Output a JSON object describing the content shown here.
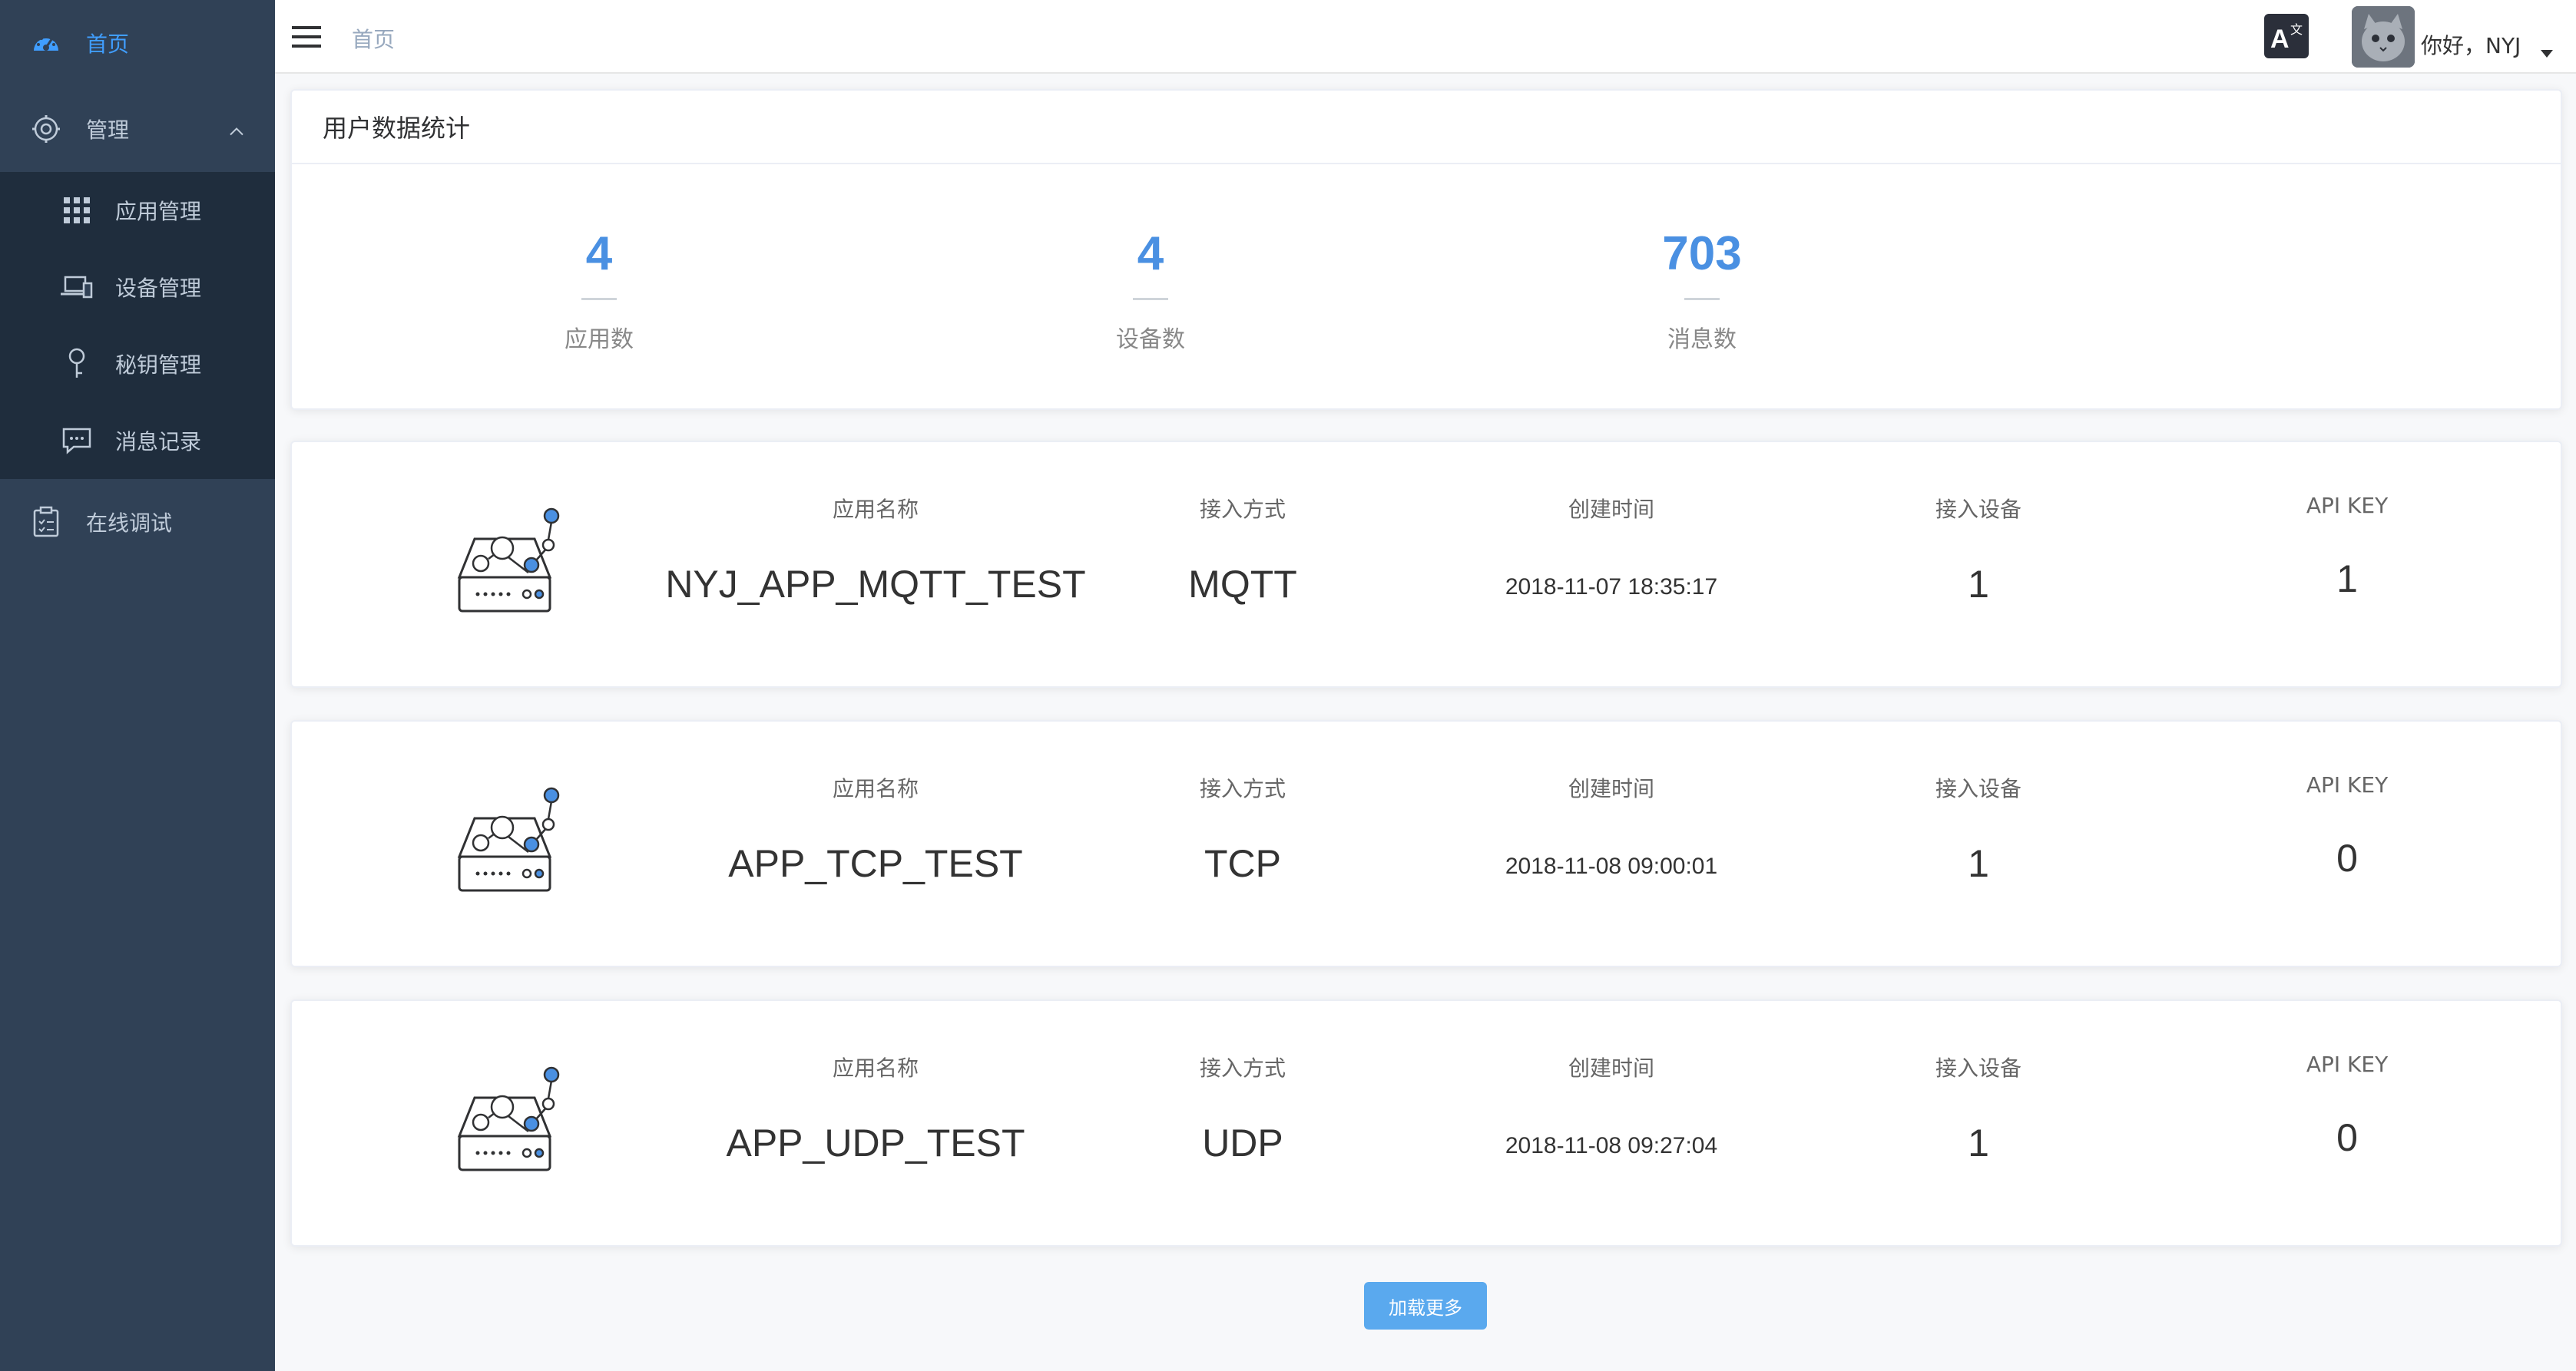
{
  "sidebar": {
    "home": {
      "label": "首页",
      "icon": "dashboard-icon"
    },
    "manage": {
      "label": "管理",
      "icon": "gear-icon"
    },
    "sub": [
      {
        "label": "应用管理",
        "icon": "grid-icon"
      },
      {
        "label": "设备管理",
        "icon": "devices-icon"
      },
      {
        "label": "秘钥管理",
        "icon": "key-icon"
      },
      {
        "label": "消息记录",
        "icon": "message-icon"
      }
    ],
    "debug": {
      "label": "在线调试",
      "icon": "clipboard-icon"
    }
  },
  "navbar": {
    "breadcrumb": "首页",
    "greeting": "你好，NYJ"
  },
  "stats": {
    "title": "用户数据统计",
    "items": [
      {
        "value": "4",
        "label": "应用数"
      },
      {
        "value": "4",
        "label": "设备数"
      },
      {
        "value": "703",
        "label": "消息数"
      }
    ]
  },
  "columns": {
    "name": "应用名称",
    "protocol": "接入方式",
    "created": "创建时间",
    "devices": "接入设备",
    "apikey": "API KEY"
  },
  "apps": [
    {
      "name": "NYJ_APP_MQTT_TEST",
      "protocol": "MQTT",
      "created": "2018-11-07 18:35:17",
      "devices": "1",
      "apikey": "1"
    },
    {
      "name": "APP_TCP_TEST",
      "protocol": "TCP",
      "created": "2018-11-08 09:00:01",
      "devices": "1",
      "apikey": "0"
    },
    {
      "name": "APP_UDP_TEST",
      "protocol": "UDP",
      "created": "2018-11-08 09:27:04",
      "devices": "1",
      "apikey": "0"
    }
  ],
  "load_more": "加载更多",
  "colors": {
    "sidebar_bg": "#304156",
    "submenu_bg": "#1f2d3d",
    "accent": "#409eff",
    "stat_value": "#4a90e2",
    "button": "#5aa9ee"
  }
}
